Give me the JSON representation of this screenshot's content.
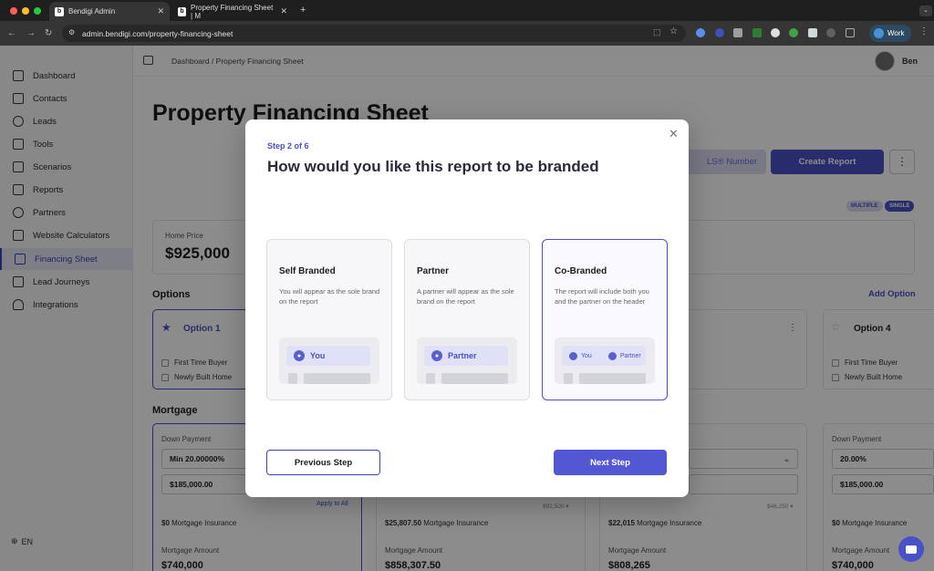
{
  "browser": {
    "tabs": [
      {
        "label": "Bendigi Admin",
        "favicon": "b"
      },
      {
        "label": "Property Financing Sheet | M",
        "favicon": "b"
      }
    ],
    "url": "admin.bendigi.com/property-financing-sheet",
    "profile_label": "Work"
  },
  "sidebar": {
    "items": [
      {
        "label": "Dashboard",
        "icon": "dashboard-icon"
      },
      {
        "label": "Contacts",
        "icon": "contacts-icon"
      },
      {
        "label": "Leads",
        "icon": "dollar-icon"
      },
      {
        "label": "Tools",
        "icon": "tools-icon"
      },
      {
        "label": "Scenarios",
        "icon": "scenarios-icon"
      },
      {
        "label": "Reports",
        "icon": "reports-icon"
      },
      {
        "label": "Partners",
        "icon": "partners-icon"
      },
      {
        "label": "Website Calculators",
        "icon": "monitor-icon"
      },
      {
        "label": "Financing Sheet",
        "icon": "sheet-icon"
      },
      {
        "label": "Lead Journeys",
        "icon": "journey-icon"
      },
      {
        "label": "Integrations",
        "icon": "integrations-icon"
      }
    ],
    "language": "EN"
  },
  "header": {
    "breadcrumb": "Dashboard  /  Property Financing Sheet",
    "user_name": "Ben"
  },
  "page": {
    "title": "Property Financing Sheet",
    "mls_button": "LS® Number",
    "create_button": "Create Report",
    "toggle_multiple": "MULTIPLE",
    "toggle_single": "SINGLE",
    "home_price_label": "Home Price",
    "home_price": "$925,000",
    "options_heading": "Options",
    "add_option": "Add Option",
    "option1": "Option 1",
    "option4": "Option 4",
    "first_time_buyer": "First Time Buyer",
    "newly_built_home": "Newly Built Home",
    "mortgage_heading": "Mortgage",
    "down_payment_label": "Down Payment",
    "col1_min": "Min 20.00000%",
    "col1_amount": "$185,000.00",
    "apply_to_all": "Apply to All",
    "col1_insurance": "$0",
    "mortgage_insurance": "Mortgage Insurance",
    "col2_insurance": "$25,807.50",
    "col2_note": "$92,500 ▾",
    "col3_insurance": "$22,015",
    "col3_note": "$46,250 ▾",
    "col4_percent": "20.00%",
    "col4_amount": "$185,000.00",
    "col4_insurance": "$0",
    "mortgage_amount_label": "Mortgage Amount",
    "amounts": [
      "$740,000",
      "$858,307.50",
      "$808,265",
      "$740,000"
    ]
  },
  "modal": {
    "step": "Step 2 of 6",
    "title": "How would you like this report to be branded",
    "options": [
      {
        "title": "Self Branded",
        "desc": "You will appear as the sole brand on the report",
        "chip": "You"
      },
      {
        "title": "Partner",
        "desc": "A partner will appear as the sole brand on the report",
        "chip": "Partner"
      },
      {
        "title": "Co-Branded",
        "desc": "The report will include both you and the partner on the header",
        "chip_a": "You",
        "chip_b": "Partner"
      }
    ],
    "selected": "Co-Branded",
    "prev_button": "Previous Step",
    "next_button": "Next Step"
  },
  "colors": {
    "accent": "#4a50c7",
    "overlay": "rgba(0,0,0,0.45)"
  }
}
